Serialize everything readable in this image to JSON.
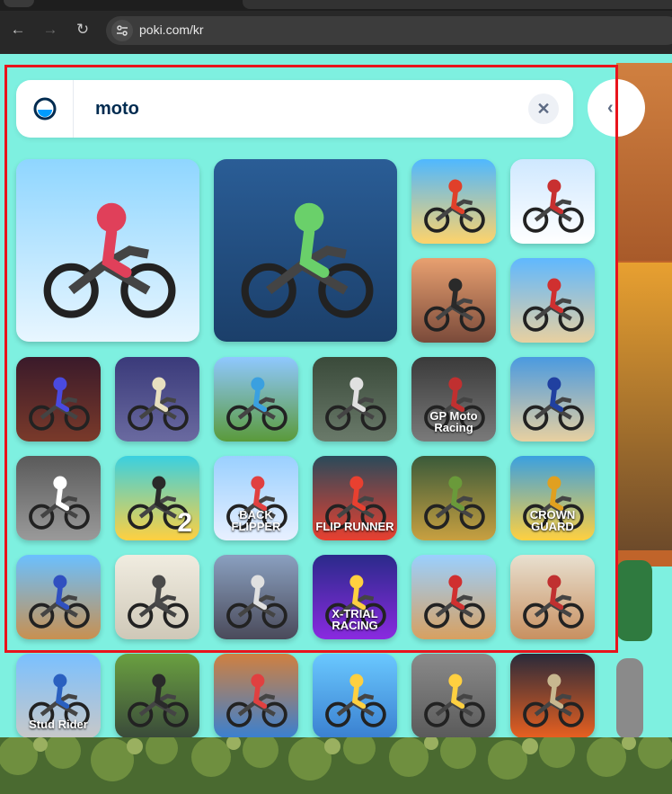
{
  "browser": {
    "back_icon": "arrow-left-icon",
    "forward_icon": "arrow-right-icon",
    "reload_icon": "reload-icon",
    "site_info_icon": "tune-icon",
    "url": "poki.com/kr"
  },
  "search": {
    "logo_icon": "poki-logo-icon",
    "query": "moto",
    "clear_icon": "close-icon",
    "back_icon": "chevron-left-icon"
  },
  "tiles": [
    {
      "id": "moto-x3m-pool",
      "label": "",
      "colors": [
        "#8fd6ff",
        "#e8f6ff"
      ],
      "rider": "#e0405a"
    },
    {
      "id": "moto-x3m",
      "label": "",
      "colors": [
        "#2a5d96",
        "#1b3f6a"
      ],
      "rider": "#6ad06a"
    },
    {
      "id": "moto-x3m-classic",
      "label": "",
      "colors": [
        "#4fb8ff",
        "#ffd36a"
      ],
      "rider": "#e0402a"
    },
    {
      "id": "moto-x3m-winter",
      "label": "",
      "colors": [
        "#cfe8ff",
        "#ffffff"
      ],
      "rider": "#c83030"
    },
    {
      "id": "moto-race",
      "label": "",
      "colors": [
        "#e8a070",
        "#7a4a3a"
      ],
      "rider": "#2a2a2a"
    },
    {
      "id": "moto-x3m-pool-party",
      "label": "",
      "colors": [
        "#5fb8ff",
        "#e8d0a0"
      ],
      "rider": "#d03030"
    },
    {
      "id": "night-bike",
      "label": "",
      "colors": [
        "#3a1a2a",
        "#7a3a2a"
      ],
      "rider": "#4a4ae0"
    },
    {
      "id": "moto-halloween",
      "label": "",
      "colors": [
        "#3a3a7a",
        "#6a6aa0"
      ],
      "rider": "#e8e0c0"
    },
    {
      "id": "hill-moto",
      "label": "",
      "colors": [
        "#8fc8ff",
        "#5a9a3a"
      ],
      "rider": "#3aa0e0"
    },
    {
      "id": "twoplayer-moto",
      "label": "",
      "colors": [
        "#3a4a3a",
        "#6a7a6a"
      ],
      "rider": "#e0e0e0"
    },
    {
      "id": "gp-moto-racing",
      "label": "GP Moto Racing",
      "colors": [
        "#3a3a3a",
        "#7a7a7a"
      ],
      "rider": "#c03030"
    },
    {
      "id": "stunt-moto",
      "label": "",
      "colors": [
        "#4a9ae0",
        "#e8d0a0"
      ],
      "rider": "#2040a0"
    },
    {
      "id": "city-moto",
      "label": "",
      "colors": [
        "#5a5a5a",
        "#9a9a9a"
      ],
      "rider": "#ffffff"
    },
    {
      "id": "moto-x3m-2",
      "label": "2",
      "colors": [
        "#3ad0e0",
        "#ffd040"
      ],
      "rider": "#2a2a2a"
    },
    {
      "id": "backflipper",
      "label": "BACK FLIPPER",
      "colors": [
        "#9ad0ff",
        "#e8f0ff"
      ],
      "rider": "#e04040"
    },
    {
      "id": "flip-runner",
      "label": "FLIP RUNNER",
      "colors": [
        "#2a4a5a",
        "#e84030"
      ],
      "rider": "#e84030"
    },
    {
      "id": "zombie-moto",
      "label": "",
      "colors": [
        "#3a5a3a",
        "#c8a040"
      ],
      "rider": "#6a9a3a"
    },
    {
      "id": "crown-guard",
      "label": "CROWN GUARD",
      "colors": [
        "#3aa0e0",
        "#ffd040"
      ],
      "rider": "#e0a020"
    },
    {
      "id": "moto-jump",
      "label": "",
      "colors": [
        "#6ac0ff",
        "#c89050"
      ],
      "rider": "#3050c0"
    },
    {
      "id": "happy-wheels",
      "label": "",
      "colors": [
        "#f0ece0",
        "#cfc8b8"
      ],
      "rider": "#4a4a4a"
    },
    {
      "id": "superbike-racing",
      "label": "",
      "colors": [
        "#8aa0c0",
        "#4a4a5a"
      ],
      "rider": "#e0e0e0"
    },
    {
      "id": "x-trial-racing",
      "label": "X-TRIAL RACING",
      "colors": [
        "#2a2a8a",
        "#8a2ae0"
      ],
      "rider": "#ffd040"
    },
    {
      "id": "desert-moto",
      "label": "",
      "colors": [
        "#9ad0ff",
        "#d8a060"
      ],
      "rider": "#d03030"
    },
    {
      "id": "motocross-race",
      "label": "",
      "colors": [
        "#e8e0d0",
        "#c89060"
      ],
      "rider": "#c03030"
    },
    {
      "id": "stud-rider",
      "label": "Stud Rider",
      "colors": [
        "#7ac0ff",
        "#c8c8c8"
      ],
      "rider": "#2a60c0"
    },
    {
      "id": "army-moto",
      "label": "",
      "colors": [
        "#6aa040",
        "#3a4a3a"
      ],
      "rider": "#2a2a2a"
    },
    {
      "id": "blocky-moto",
      "label": "",
      "colors": [
        "#d08040",
        "#3a80d0"
      ],
      "rider": "#e04040"
    },
    {
      "id": "sky-moto",
      "label": "",
      "colors": [
        "#6ac8ff",
        "#3a80d0"
      ],
      "rider": "#ffd040"
    },
    {
      "id": "highway-moto",
      "label": "",
      "colors": [
        "#8a8a8a",
        "#5a5a5a"
      ],
      "rider": "#ffd040"
    },
    {
      "id": "truck-stunt",
      "label": "",
      "colors": [
        "#2a2a3a",
        "#e86020"
      ],
      "rider": "#c8b890"
    }
  ]
}
